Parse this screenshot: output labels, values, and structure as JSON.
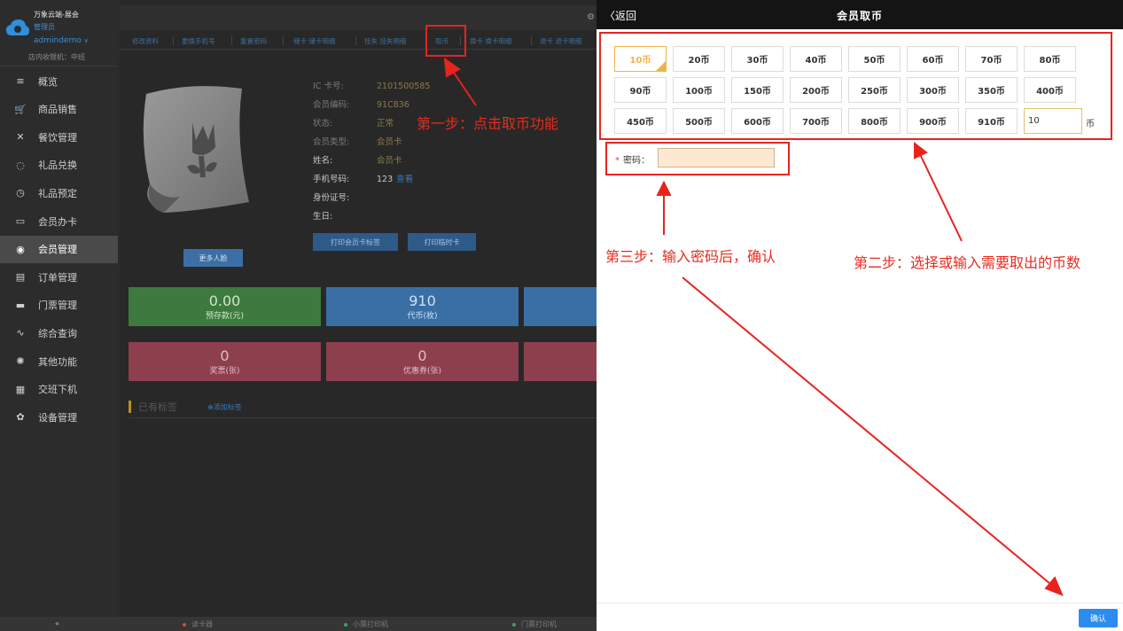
{
  "sidebar": {
    "brand_title": "万象云端-展会",
    "brand_role": "管理员",
    "brand_user": "admindemo",
    "brand_cashier": "店内收银机：中班",
    "items": [
      {
        "label": "概览",
        "icon": "menu-lines-icon"
      },
      {
        "label": "商品销售",
        "icon": "cart-icon"
      },
      {
        "label": "餐饮管理",
        "icon": "utensils-icon"
      },
      {
        "label": "礼品兑换",
        "icon": "gift-icon"
      },
      {
        "label": "礼品预定",
        "icon": "alarm-clock-icon"
      },
      {
        "label": "会员办卡",
        "icon": "card-icon"
      },
      {
        "label": "会员管理",
        "icon": "member-icon"
      },
      {
        "label": "订单管理",
        "icon": "clipboard-icon"
      },
      {
        "label": "门票管理",
        "icon": "printer-icon"
      },
      {
        "label": "综合查询",
        "icon": "pulse-icon"
      },
      {
        "label": "其他功能",
        "icon": "aperture-icon"
      },
      {
        "label": "交班下机",
        "icon": "calculator-icon"
      },
      {
        "label": "设备管理",
        "icon": "gear-icon"
      }
    ],
    "active_index": 6
  },
  "main": {
    "tabs": [
      "修改资料",
      "更换手机号",
      "重置密码",
      "储卡 储卡明细",
      "挂失 挂失明细",
      "取币",
      "换卡 换卡明细",
      "退卡 退卡明细"
    ],
    "member": {
      "ic_label": "IC 卡号:",
      "ic_value": "2101500585",
      "code_label": "会员编码:",
      "code_value": "91C836",
      "status_label": "状态:",
      "status_value": "正常",
      "type_label": "会员类型:",
      "type_value": "会员卡",
      "name_label": "姓名:",
      "name_value": "会员卡",
      "phone_label": "手机号码:",
      "phone_value": "123",
      "phone_link": "查看",
      "id_label": "身份证号:",
      "id_value": "",
      "birthday_label": "生日:",
      "birthday_value": ""
    },
    "more_faces": "更多人脸",
    "print_label": "打印会员卡标签",
    "print_temp": "打印临时卡",
    "stats": [
      {
        "value": "0.00",
        "label": "预存款(元)",
        "color": "green"
      },
      {
        "value": "910",
        "label": "代币(枚)",
        "color": "blue"
      },
      {
        "value": "",
        "label": "",
        "color": "blue"
      },
      {
        "value": "0",
        "label": "奖票(张)",
        "color": "red"
      },
      {
        "value": "0",
        "label": "优惠券(张)",
        "color": "red"
      },
      {
        "value": "",
        "label": "",
        "color": "red"
      }
    ],
    "tags_title": "已有标签",
    "add_tag": "添加标签"
  },
  "statusbar": {
    "collapse": "«",
    "card_reader": "读卡器",
    "receipt_printer": "小票打印机",
    "ticket_printer": "门票打印机"
  },
  "panel": {
    "back": "返回",
    "title": "会员取币",
    "coins": [
      "10币",
      "20币",
      "30币",
      "40币",
      "50币",
      "60币",
      "70币",
      "80币",
      "90币",
      "100币",
      "150币",
      "200币",
      "250币",
      "300币",
      "350币",
      "400币",
      "450币",
      "500币",
      "600币",
      "700币",
      "800币",
      "900币",
      "910币"
    ],
    "selected_coin": "10币",
    "custom_value": "10",
    "coin_unit": "币",
    "password_label": "密码：",
    "confirm": "确认"
  },
  "annotations": {
    "step1": "第一步：点击取币功能",
    "step2": "第二步：选择或输入需要取出的币数",
    "step3": "第三步：输入密码后，确认"
  },
  "colors": {
    "annotation_red": "#e8231e",
    "selected_orange": "#f1b24a",
    "confirm_blue": "#2d8cf0",
    "sidebar_bg": "#2c2c2c"
  }
}
